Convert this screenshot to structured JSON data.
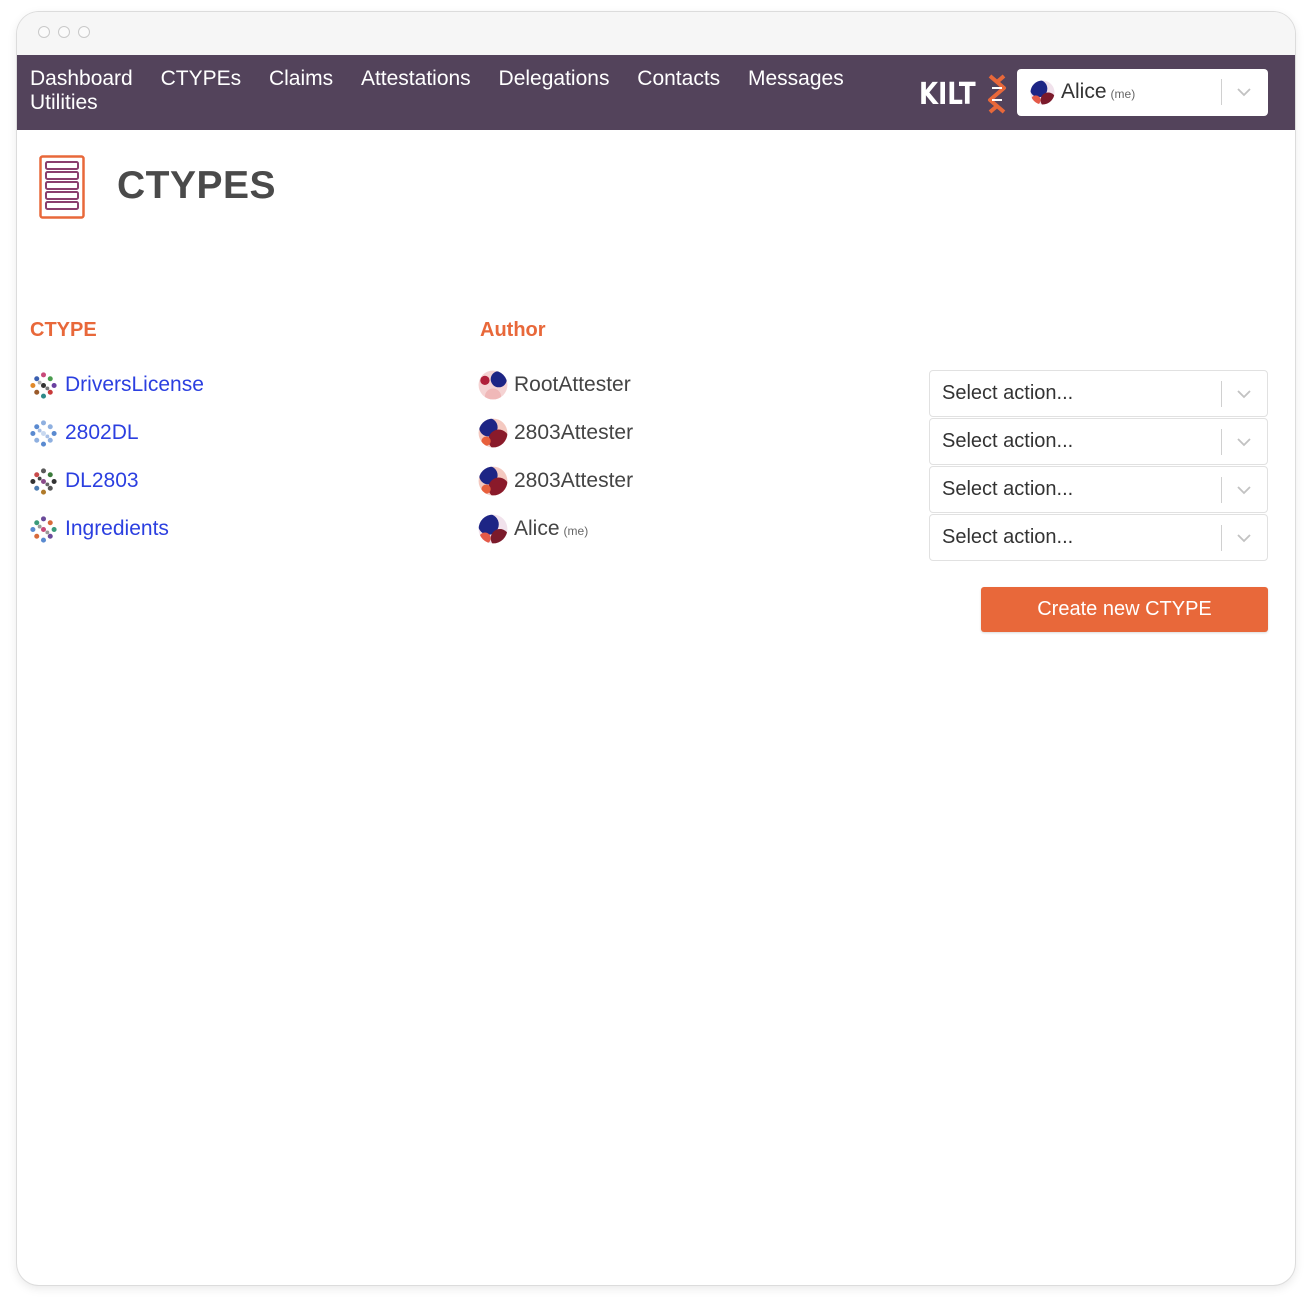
{
  "nav": {
    "links": [
      "Dashboard",
      "CTYPEs",
      "Claims",
      "Attestations",
      "Delegations",
      "Contacts",
      "Messages",
      "Utilities"
    ],
    "logo_text": "KILT"
  },
  "identity": {
    "name": "Alice",
    "tag": "(me)"
  },
  "page": {
    "title": "CTYPES",
    "icon": "ctype-list-icon"
  },
  "table": {
    "headers": {
      "ctype": "CTYPE",
      "author": "Author"
    },
    "rows": [
      {
        "ctype": "DriversLicense",
        "author": "RootAttester",
        "author_tag": "",
        "action_placeholder": "Select action..."
      },
      {
        "ctype": "2802DL",
        "author": "2803Attester",
        "author_tag": "",
        "action_placeholder": "Select action..."
      },
      {
        "ctype": "DL2803",
        "author": "2803Attester",
        "author_tag": "",
        "action_placeholder": "Select action..."
      },
      {
        "ctype": "Ingredients",
        "author": "Alice",
        "author_tag": "(me)",
        "action_placeholder": "Select action..."
      }
    ]
  },
  "create_button_label": "Create new CTYPE",
  "colors": {
    "nav_bg": "#53435b",
    "accent": "#e8683a",
    "link": "#2b3fe0"
  }
}
